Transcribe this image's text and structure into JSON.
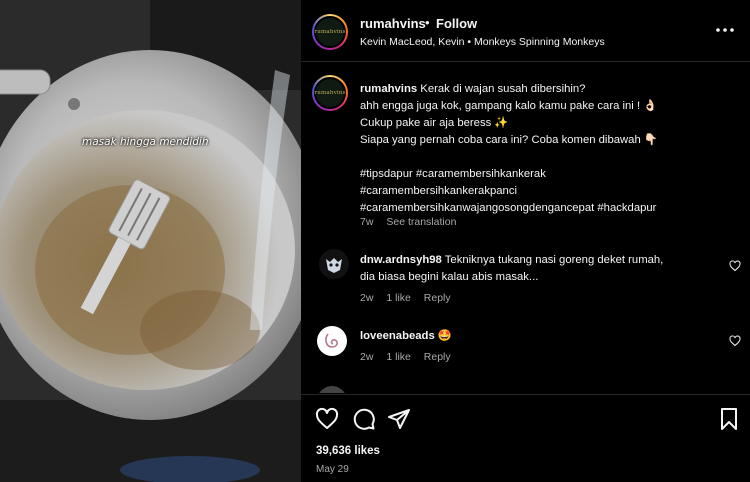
{
  "media": {
    "overlay_text": "masak hingga mendidih"
  },
  "header": {
    "avatar_text": "rumahvins",
    "username": "rumahvins",
    "separator": "•",
    "follow_label": "Follow",
    "audio": "Kevin MacLeod, Kevin • Monkeys Spinning Monkeys",
    "more_icon": "more-horizontal-icon"
  },
  "caption": {
    "username": "rumahvins",
    "lines": [
      "Kerak di wajan susah dibersihin?",
      "ahh engga juga kok, gampang kalo kamu pake cara ini ! 👌🏻",
      "Cukup pake air aja beress ✨",
      "Siapa yang pernah coba cara ini? Coba komen dibawah 👇🏻"
    ],
    "hashtags": [
      "#tipsdapur #caramembersihkankerak",
      "#caramembersihkankerakpanci",
      "#caramembersihkanwajangosongdengancepat #hackdapur"
    ],
    "age": "7w",
    "translation_label": "See translation"
  },
  "comments": [
    {
      "username": "dnw.ardnsyh98",
      "text_line1": "Tekniknya tukang nasi goreng deket rumah,",
      "text_line2": "dia biasa begini kalau abis masak...",
      "age": "2w",
      "likes": "1 like",
      "reply_label": "Reply"
    },
    {
      "username": "loveenabeads",
      "text": "🤩",
      "age": "2w",
      "likes": "1 like",
      "reply_label": "Reply"
    }
  ],
  "actions": {
    "like_icon": "heart-icon",
    "comment_icon": "comment-icon",
    "share_icon": "share-icon",
    "save_icon": "bookmark-icon",
    "likes": "39,636 likes",
    "date": "May 29"
  },
  "colors": {
    "background": "#000000",
    "text": "#f5f5f5",
    "secondary_text": "#a8a8a8",
    "divider": "#262626"
  }
}
